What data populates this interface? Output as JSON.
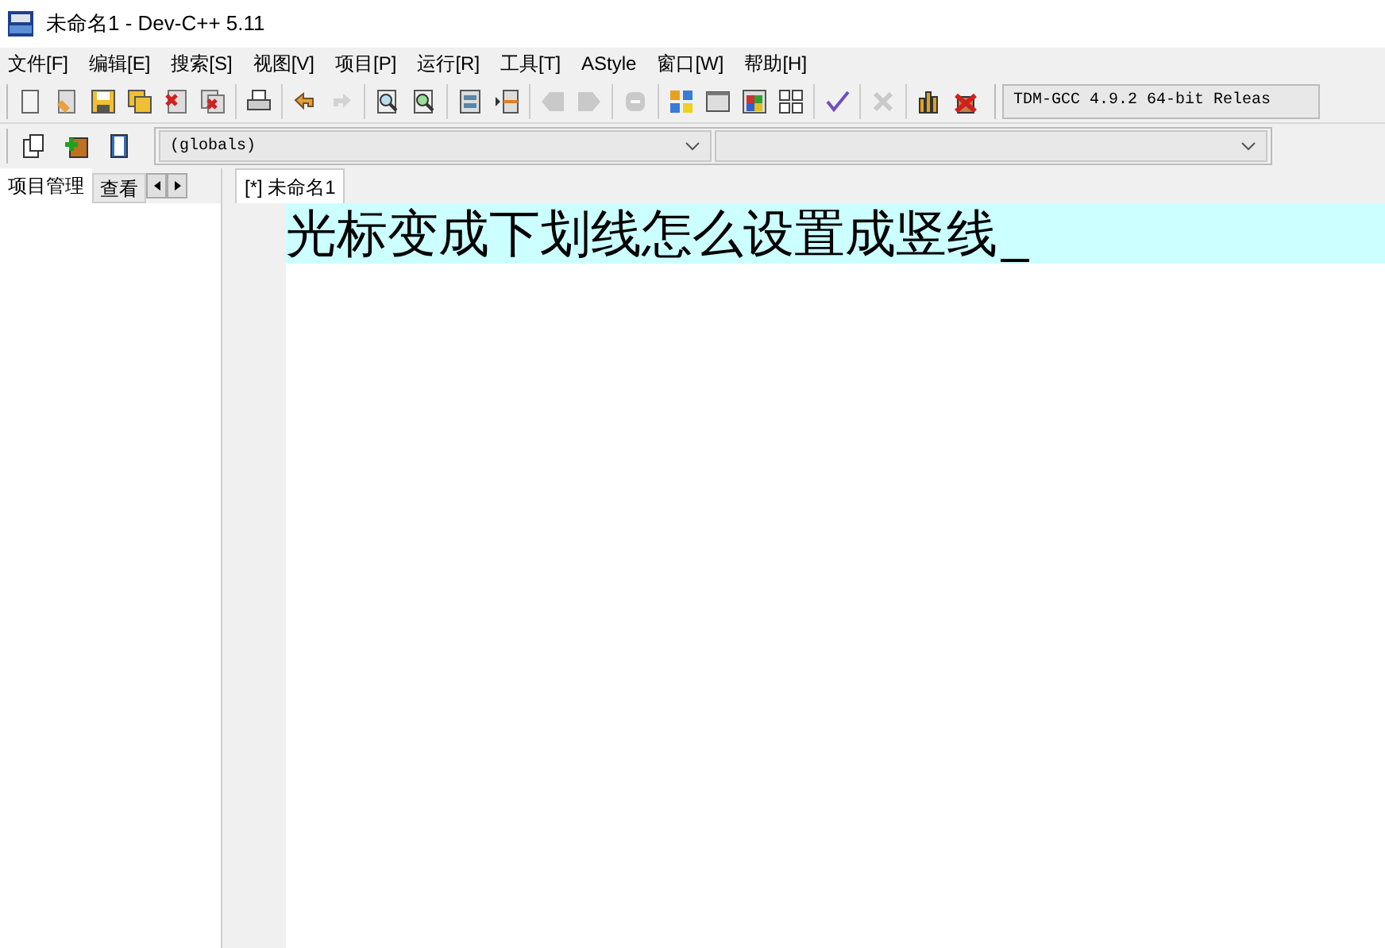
{
  "window": {
    "title": "未命名1 - Dev-C++ 5.11"
  },
  "menu": [
    "文件[F]",
    "编辑[E]",
    "搜索[S]",
    "视图[V]",
    "项目[P]",
    "运行[R]",
    "工具[T]",
    "AStyle",
    "窗口[W]",
    "帮助[H]"
  ],
  "toolbar": [
    [
      {
        "kind": "new",
        "disabled": false
      },
      {
        "kind": "open",
        "disabled": false
      },
      {
        "kind": "save",
        "disabled": false
      },
      {
        "kind": "saveall",
        "disabled": false
      },
      {
        "kind": "close",
        "disabled": false
      },
      {
        "kind": "closeall",
        "disabled": false
      }
    ],
    [
      {
        "kind": "print",
        "disabled": false
      }
    ],
    [
      {
        "kind": "undo",
        "disabled": false
      },
      {
        "kind": "redo",
        "disabled": true
      }
    ],
    [
      {
        "kind": "find",
        "disabled": false
      },
      {
        "kind": "replace",
        "disabled": false
      }
    ],
    [
      {
        "kind": "indent",
        "disabled": false
      },
      {
        "kind": "unindent",
        "disabled": false
      }
    ],
    [
      {
        "kind": "back",
        "disabled": true
      },
      {
        "kind": "forward",
        "disabled": true
      }
    ],
    [
      {
        "kind": "stop",
        "disabled": true
      }
    ],
    [
      {
        "kind": "grid",
        "disabled": false
      },
      {
        "kind": "window",
        "disabled": false
      },
      {
        "kind": "colors",
        "disabled": false
      },
      {
        "kind": "tiles",
        "disabled": false
      }
    ],
    [
      {
        "kind": "check",
        "disabled": false
      }
    ],
    [
      {
        "kind": "delete",
        "disabled": true
      }
    ],
    [
      {
        "kind": "chart",
        "disabled": false
      },
      {
        "kind": "profile",
        "disabled": false
      }
    ]
  ],
  "compiler": "TDM-GCC 4.9.2 64-bit Releas",
  "toolbar2": [
    {
      "kind": "newproject"
    },
    {
      "kind": "addfile"
    },
    {
      "kind": "book"
    }
  ],
  "scope_dropdown": {
    "value": "(globals)"
  },
  "left_tabs": [
    {
      "label": "项目管理",
      "selected": true
    },
    {
      "label": "查看",
      "selected": false
    }
  ],
  "editor_tabs": [
    {
      "label": "[*] 未命名1",
      "selected": true
    }
  ],
  "editor": {
    "lines": [
      "光标变成下划线怎么设置成竖线"
    ]
  }
}
